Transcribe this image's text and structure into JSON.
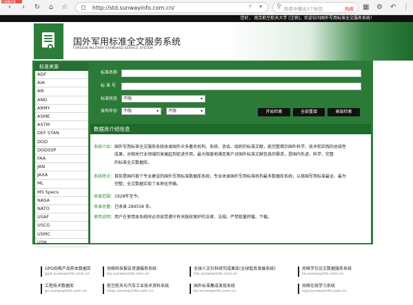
{
  "browser": {
    "tag": "已收藏书签",
    "url": "http://std.sunwayinfo.com.cn/",
    "search_placeholder": "奶茶中曝出3个标签",
    "search_hot": "热搜"
  },
  "topbar": {
    "text": "您好， 南京航空航天大学 [注销]，欢迎访问国外军用标准全文服务系统！"
  },
  "header": {
    "title": "国外军用标准全文服务系统",
    "subtitle": "FOREIGN MILITARY STANDARD SERVICE SYSTEM"
  },
  "sidebar": {
    "heading": "标准来源",
    "items": [
      "ADF",
      "AIA",
      "AN",
      "AND",
      "ARMY",
      "ASME",
      "ASTM",
      "DEF STAN",
      "DOD",
      "DODSSP",
      "FAA",
      "JAN",
      "JAXA",
      "ML",
      "MS Specs",
      "NASA",
      "NATO",
      "USAF",
      "USCG",
      "USMC",
      "USN"
    ]
  },
  "search": {
    "name_label": "标准名称",
    "number_label": "标 准 号",
    "status_label": "标准状态",
    "status_value": "不限",
    "year_label": "发布年份",
    "year_from": "不限",
    "year_sep": "-",
    "year_to": "不限",
    "btn_search": "开始检索",
    "btn_reset": "全部重填",
    "btn_advanced": "高级检索"
  },
  "info": {
    "heading": "数据库介绍信息",
    "rows": [
      {
        "key": "系统介绍：",
        "lines": [
          "国外军用标准全文服务系统收录国外众多著名机构、系统、协会、组织的标准文献，能完整揭示国外科学、技术和实践的总结性",
          "成果，对相关行业领域的发展起到促进作用，最大限度地满足客户对国外标准文献信息的需求，是国内先进、科学、完整",
          "的标准全文数据库。"
        ]
      },
      {
        "key": "系统特点：",
        "lines": [
          "目前是国内首个专业建设的国外军用标准数据库系统；专业收录国外军用标准机构最多数据库系统；以美国军用标准最全、最为",
          "完整；全文数据实现了本地化传输。"
        ]
      },
      {
        "key": "收录范围：",
        "lines": [
          "1928年至今。"
        ]
      },
      {
        "key": "收录总量：",
        "lines": [
          "已收录 289558 条。"
        ]
      },
      {
        "key": "使用说明：",
        "lines": [
          "用户在使用本系统时必须自觉遵守有关版权保护的法律、法规。严禁批量转载、下载。"
        ]
      }
    ]
  },
  "footer": {
    "links": [
      {
        "title": "GPD尚唯产品样本数据库",
        "url": "gpd.sunwayinfo.com.cn"
      },
      {
        "title": "尚唯科技报告资源服务系统",
        "url": "bg.sunwayinfo.com.cn"
      },
      {
        "title": "全球人文社科研究成果库(全球智库发展系统)",
        "url": "tds.sunwayinfo.com.cn"
      },
      {
        "title": "尚唯学位论文数据服务系统",
        "url": "lw.sunwayinfo.com.cn"
      },
      {
        "title": "工程技术数据库",
        "url": "gc.sunwayinfo.com.cn"
      },
      {
        "title": "航空航天与汽车工业技术资料系统",
        "url": "hkqc.sunwayinfo.com.cn"
      },
      {
        "title": "国外标准集成发现系统",
        "url": "bz.sunwayinfo.com.cn"
      },
      {
        "title": "尚唯在线学习系统",
        "url": "zyjy.sunwayinfo.com.cn"
      }
    ]
  }
}
